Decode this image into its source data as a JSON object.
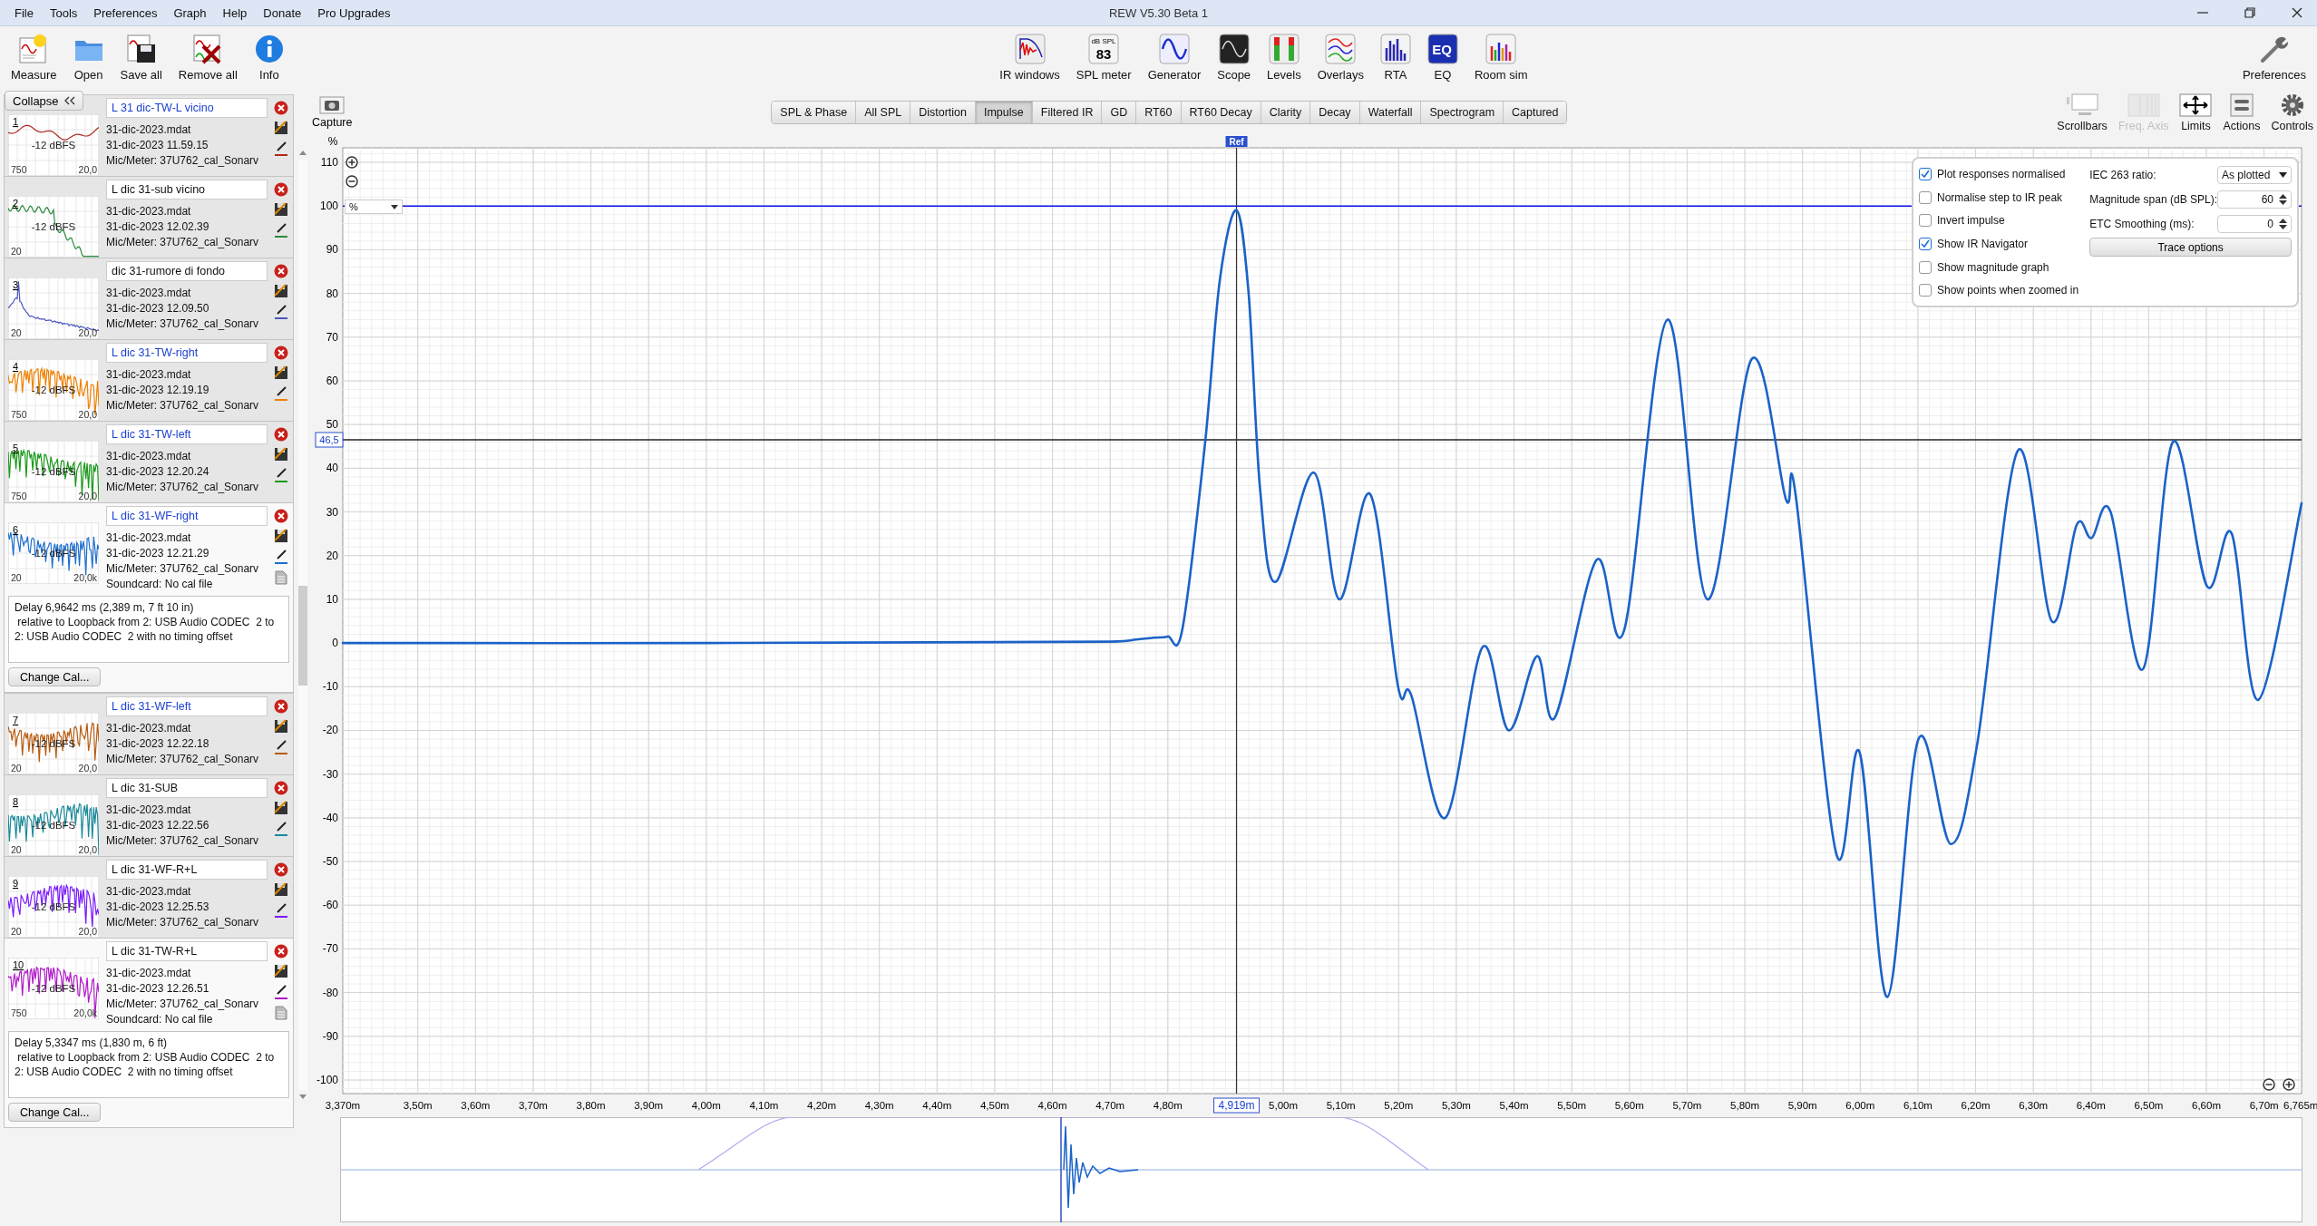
{
  "window": {
    "title": "REW V5.30 Beta 1"
  },
  "menu": [
    "File",
    "Tools",
    "Preferences",
    "Graph",
    "Help",
    "Donate",
    "Pro Upgrades"
  ],
  "toolbar_left": [
    {
      "label": "Measure"
    },
    {
      "label": "Open"
    },
    {
      "label": "Save all"
    },
    {
      "label": "Remove all"
    },
    {
      "label": "Info"
    }
  ],
  "toolbar_center": [
    {
      "label": "IR windows"
    },
    {
      "label": "SPL meter",
      "icon_text": [
        "dB SPL",
        "83"
      ]
    },
    {
      "label": "Generator"
    },
    {
      "label": "Scope"
    },
    {
      "label": "Levels"
    },
    {
      "label": "Overlays"
    },
    {
      "label": "RTA"
    },
    {
      "label": "EQ",
      "icon_text": [
        "EQ"
      ]
    },
    {
      "label": "Room sim"
    }
  ],
  "toolbar_right": [
    {
      "label": "Preferences"
    }
  ],
  "collapse_button": "Collapse",
  "measurements": [
    {
      "number": "1",
      "name": "L 31 dic-TW-L vicino",
      "highlighted": true,
      "file": "31-dic-2023.mdat",
      "date": "31-dic-2023 11.59.15",
      "mic": "Mic/Meter: 37U762_cal_Sonarv",
      "color": "#b0281c",
      "level_label": "-12 dBFS",
      "left_label": "750",
      "right_label": "20,0",
      "expanded": false
    },
    {
      "number": "2",
      "name": "L dic 31-sub vicino",
      "highlighted": false,
      "file": "31-dic-2023.mdat",
      "date": "31-dic-2023 12.02.39",
      "mic": "Mic/Meter: 37U762_cal_Sonarv",
      "color": "#2a8a3a",
      "level_label": "-12 dBFS",
      "left_label": "20",
      "expanded": false
    },
    {
      "number": "3",
      "name": "dic 31-rumore di fondo",
      "highlighted": false,
      "file": "31-dic-2023.mdat",
      "date": "31-dic-2023 12.09.50",
      "mic": "Mic/Meter: 37U762_cal_Sonarv",
      "color": "#4a55c0",
      "left_label": "20",
      "right_label": "20,0",
      "expanded": false
    },
    {
      "number": "4",
      "name": "L dic 31-TW-right",
      "highlighted": true,
      "file": "31-dic-2023.mdat",
      "date": "31-dic-2023 12.19.19",
      "mic": "Mic/Meter: 37U762_cal_Sonarv",
      "color": "#f08000",
      "level_label": "-12 dBFS",
      "left_label": "750",
      "right_label": "20,0",
      "expanded": false
    },
    {
      "number": "5",
      "name": "L dic 31-TW-left",
      "highlighted": true,
      "file": "31-dic-2023.mdat",
      "date": "31-dic-2023 12.20.24",
      "mic": "Mic/Meter: 37U762_cal_Sonarv",
      "color": "#1a9a1a",
      "level_label": "-12 dBFS",
      "left_label": "750",
      "right_label": "20,0",
      "expanded": false
    },
    {
      "number": "6",
      "name": "L dic 31-WF-right",
      "highlighted": true,
      "file": "31-dic-2023.mdat",
      "date": "31-dic-2023 12.21.29",
      "mic": "Mic/Meter: 37U762_cal_Sonarv",
      "color": "#1e6fd0",
      "level_label": "-12 dBFS",
      "left_label": "20",
      "right_label": "20,0k",
      "expanded": true,
      "soundcard": "Soundcard: No cal file",
      "delay": "Delay 6,9642 ms (2,389 m, 7 ft 10 in)\n relative to Loopback from 2: USB Audio CODEC  2 to\n2: USB Audio CODEC  2 with no timing offset",
      "button": "Change Cal..."
    },
    {
      "number": "7",
      "name": "L dic 31-WF-left",
      "highlighted": true,
      "file": "31-dic-2023.mdat",
      "date": "31-dic-2023 12.22.18",
      "mic": "Mic/Meter: 37U762_cal_Sonarv",
      "color": "#b85c10",
      "level_label": "-12 dBFS",
      "left_label": "20",
      "right_label": "20,0",
      "expanded": false
    },
    {
      "number": "8",
      "name": "L dic 31-SUB",
      "highlighted": false,
      "file": "31-dic-2023.mdat",
      "date": "31-dic-2023 12.22.56",
      "mic": "Mic/Meter: 37U762_cal_Sonarv",
      "color": "#1a8a9a",
      "level_label": "-12 dBFS",
      "left_label": "20",
      "right_label": "20,0",
      "expanded": false
    },
    {
      "number": "9",
      "name": "L dic 31-WF-R+L",
      "highlighted": false,
      "file": "31-dic-2023.mdat",
      "date": "31-dic-2023 12.25.53",
      "mic": "Mic/Meter: 37U762_cal_Sonarv",
      "color": "#7a1aff",
      "level_label": "-12 dBFS",
      "left_label": "20",
      "right_label": "20,0",
      "expanded": false
    },
    {
      "number": "10",
      "name": "L dic 31-TW-R+L",
      "highlighted": false,
      "file": "31-dic-2023.mdat",
      "date": "31-dic-2023 12.26.51",
      "mic": "Mic/Meter: 37U762_cal_Sonarv",
      "color": "#b01ac8",
      "level_label": "-12 dBFS",
      "left_label": "750",
      "right_label": "20,0k",
      "expanded": true,
      "soundcard": "Soundcard: No cal file",
      "delay": "Delay 5,3347 ms (1,830 m, 6 ft)\n relative to Loopback from 2: USB Audio CODEC  2 to\n2: USB Audio CODEC  2 with no timing offset",
      "button": "Change Cal..."
    }
  ],
  "capture": {
    "label": "Capture"
  },
  "tabs": [
    {
      "label": "SPL & Phase",
      "selected": false
    },
    {
      "label": "All SPL",
      "selected": false
    },
    {
      "label": "Distortion",
      "selected": false
    },
    {
      "label": "Impulse",
      "selected": true
    },
    {
      "label": "Filtered IR",
      "selected": false
    },
    {
      "label": "GD",
      "selected": false
    },
    {
      "label": "RT60",
      "selected": false
    },
    {
      "label": "RT60 Decay",
      "selected": false
    },
    {
      "label": "Clarity",
      "selected": false
    },
    {
      "label": "Decay",
      "selected": false
    },
    {
      "label": "Waterfall",
      "selected": false
    },
    {
      "label": "Spectrogram",
      "selected": false
    },
    {
      "label": "Captured",
      "selected": false
    }
  ],
  "graph_tools": [
    {
      "label": "Scrollbars",
      "disabled": false
    },
    {
      "label": "Freq. Axis",
      "disabled": true
    },
    {
      "label": "Limits",
      "disabled": false
    },
    {
      "label": "Actions",
      "disabled": false
    },
    {
      "label": "Controls",
      "disabled": false
    }
  ],
  "chart": {
    "unit": "%",
    "unit_selector": "%",
    "chart_data": {
      "type": "line",
      "x": [
        3.37,
        4.0,
        4.5,
        4.7,
        4.745,
        4.775,
        4.8,
        4.825,
        4.864,
        4.89,
        4.919,
        4.94,
        4.96,
        4.987,
        5.053,
        5.097,
        5.151,
        5.199,
        5.222,
        5.281,
        5.345,
        5.391,
        5.44,
        5.471,
        5.543,
        5.591,
        5.666,
        5.735,
        5.812,
        5.871,
        5.888,
        5.958,
        5.999,
        6.047,
        6.101,
        6.157,
        6.203,
        6.273,
        6.332,
        6.375,
        6.401,
        6.434,
        6.49,
        6.542,
        6.601,
        6.644,
        6.69,
        6.765
      ],
      "series": [
        {
          "color": "#1b62c8",
          "values": [
            0,
            0,
            0.2,
            0.3,
            0.8,
            1.2,
            1.5,
            3,
            45,
            83,
            99,
            80,
            35,
            14,
            39,
            10,
            34,
            -10,
            -12,
            -40,
            -1,
            -20,
            -3,
            -17,
            19,
            3,
            74,
            10,
            65,
            33,
            34,
            -48,
            -25,
            -81,
            -22,
            -46,
            -23,
            44,
            5,
            27,
            24,
            30,
            -6,
            46,
            13,
            25,
            -13,
            32
          ]
        }
      ],
      "xlim": [
        3.37,
        6.765
      ],
      "ylim": [
        -100,
        110
      ],
      "grid": true,
      "xticks": [
        {
          "value": 3.5,
          "label": "3,50m"
        },
        {
          "value": 3.6,
          "label": "3,60m"
        },
        {
          "value": 3.7,
          "label": "3,70m"
        },
        {
          "value": 3.8,
          "label": "3,80m"
        },
        {
          "value": 3.9,
          "label": "3,90m"
        },
        {
          "value": 4.0,
          "label": "4,00m"
        },
        {
          "value": 4.1,
          "label": "4,10m"
        },
        {
          "value": 4.2,
          "label": "4,20m"
        },
        {
          "value": 4.3,
          "label": "4,30m"
        },
        {
          "value": 4.4,
          "label": "4,40m"
        },
        {
          "value": 4.5,
          "label": "4,50m"
        },
        {
          "value": 4.6,
          "label": "4,60m"
        },
        {
          "value": 4.7,
          "label": "4,70m"
        },
        {
          "value": 4.8,
          "label": "4,80m"
        },
        {
          "value": 5.0,
          "label": "5,00m"
        },
        {
          "value": 5.1,
          "label": "5,10m"
        },
        {
          "value": 5.2,
          "label": "5,20m"
        },
        {
          "value": 5.3,
          "label": "5,30m"
        },
        {
          "value": 5.4,
          "label": "5,40m"
        },
        {
          "value": 5.5,
          "label": "5,50m"
        },
        {
          "value": 5.6,
          "label": "5,60m"
        },
        {
          "value": 5.7,
          "label": "5,70m"
        },
        {
          "value": 5.8,
          "label": "5,80m"
        },
        {
          "value": 5.9,
          "label": "5,90m"
        },
        {
          "value": 6.0,
          "label": "6,00m"
        },
        {
          "value": 6.1,
          "label": "6,10m"
        },
        {
          "value": 6.2,
          "label": "6,20m"
        },
        {
          "value": 6.3,
          "label": "6,30m"
        },
        {
          "value": 6.4,
          "label": "6,40m"
        },
        {
          "value": 6.5,
          "label": "6,50m"
        },
        {
          "value": 6.6,
          "label": "6,60m"
        },
        {
          "value": 6.7,
          "label": "6,70m"
        }
      ],
      "yticks": [
        110,
        100,
        90,
        80,
        70,
        60,
        50,
        40,
        30,
        20,
        10,
        0,
        -10,
        -20,
        -30,
        -40,
        -50,
        -60,
        -70,
        -80,
        -90,
        -100
      ],
      "ref_lines": [
        {
          "axis": "y",
          "value": 100
        },
        {
          "axis": "y",
          "value": 46.5,
          "label": "46,5"
        },
        {
          "axis": "x",
          "value": 4.919,
          "label": "4,919m"
        }
      ]
    },
    "x_start_label": "3,370m",
    "x_end_label": "6,765m",
    "ref_flag": "Ref"
  },
  "options": {
    "checkboxes": [
      {
        "label": "Plot responses normalised",
        "checked": true
      },
      {
        "label": "Normalise step to IR peak",
        "checked": false
      },
      {
        "label": "Invert impulse",
        "checked": false
      },
      {
        "label": "Show IR Navigator",
        "checked": true
      },
      {
        "label": "Show magnitude graph",
        "checked": false
      },
      {
        "label": "Show points when zoomed in",
        "checked": false
      }
    ],
    "fields": [
      {
        "label": "IEC 263 ratio:",
        "kind": "dropdown",
        "value": "As plotted"
      },
      {
        "label": "Magnitude span (dB SPL):",
        "kind": "spinner",
        "value": "60"
      },
      {
        "label": "ETC Smoothing (ms):",
        "kind": "spinner",
        "value": "0"
      }
    ],
    "button": "Trace options"
  }
}
